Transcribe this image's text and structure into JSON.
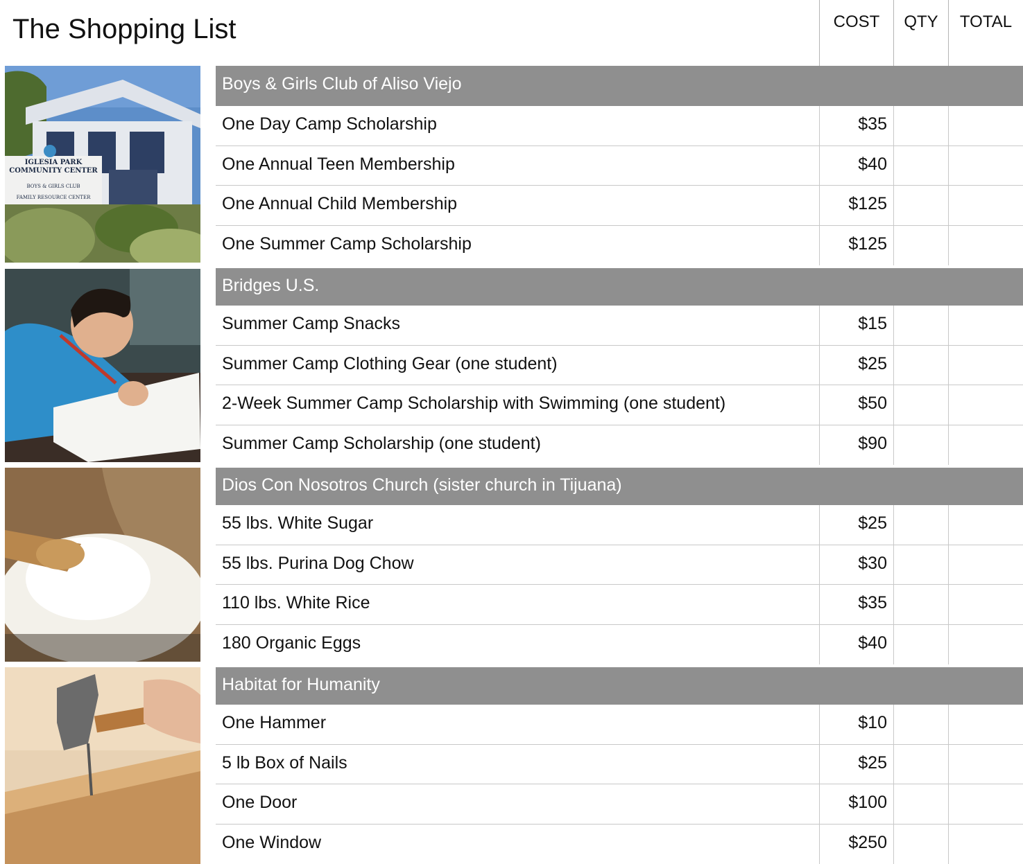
{
  "title": "The Shopping List",
  "columns": {
    "cost": "COST",
    "qty": "QTY",
    "total": "TOTAL"
  },
  "sections": [
    {
      "name": "Boys & Girls Club of Aliso Viejo",
      "photo": "community-center-photo",
      "photo_sign": [
        "IGLESIA PARK",
        "COMMUNITY CENTER",
        "BOYS & GIRLS CLUB",
        "FAMILY RESOURCE CENTER"
      ],
      "items": [
        {
          "label": "One Day Camp Scholarship",
          "cost": "$35"
        },
        {
          "label": "One Annual Teen Membership",
          "cost": "$40"
        },
        {
          "label": "One Annual Child Membership",
          "cost": "$125"
        },
        {
          "label": "One Summer Camp Scholarship",
          "cost": "$125"
        }
      ]
    },
    {
      "name": "Bridges U.S.",
      "photo": "child-writing-photo",
      "items": [
        {
          "label": "Summer Camp Snacks",
          "cost": "$15"
        },
        {
          "label": "Summer Camp Clothing Gear (one student)",
          "cost": "$25"
        },
        {
          "label": "2-Week Summer Camp Scholarship with Swimming (one student)",
          "cost": "$50"
        },
        {
          "label": "Summer Camp Scholarship (one student)",
          "cost": "$90"
        }
      ]
    },
    {
      "name": "Dios Con Nosotros Church (sister church in Tijuana)",
      "photo": "rice-sack-photo",
      "items": [
        {
          "label": "55 lbs. White Sugar",
          "cost": "$25"
        },
        {
          "label": "55 lbs. Purina Dog Chow",
          "cost": "$30"
        },
        {
          "label": "110 lbs. White Rice",
          "cost": "$35"
        },
        {
          "label": "180 Organic Eggs",
          "cost": "$40"
        }
      ]
    },
    {
      "name": "Habitat for Humanity",
      "photo": "hammer-nail-photo",
      "items": [
        {
          "label": "One Hammer",
          "cost": "$10"
        },
        {
          "label": "5 lb Box of Nails",
          "cost": "$25"
        },
        {
          "label": "One Door",
          "cost": "$100"
        },
        {
          "label": "One Window",
          "cost": "$250"
        }
      ]
    }
  ]
}
